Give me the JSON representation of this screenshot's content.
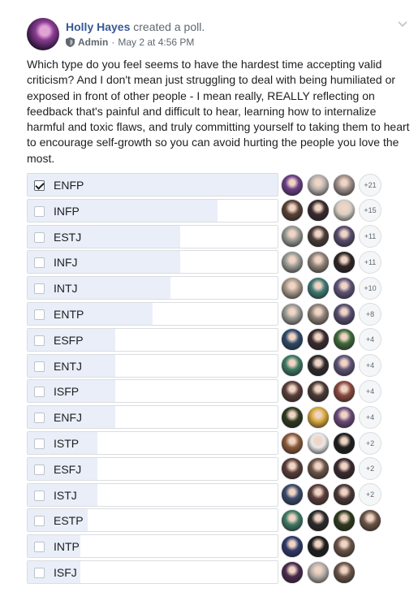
{
  "post": {
    "author": "Holly Hayes",
    "action": "created a poll.",
    "role": "Admin",
    "separator": "·",
    "timestamp": "May 2 at 4:56 PM",
    "text": "Which type do you feel seems to have the hardest time accepting valid criticism? And I don't mean just struggling to deal with being humiliated or exposed in front of other people - I mean really, REALLY reflecting on feedback that's painful and difficult to hear, learning how to internalize harmful and toxic flaws, and truly committing yourself to taking them to heart to encourage self-growth so you can avoid hurting the people you love the most."
  },
  "icons": {
    "menu": "chevron-down-icon",
    "role": "shield-icon",
    "check": "checkmark-icon"
  },
  "colors": {
    "author": "#385898",
    "bar_fill": "#e9eef8",
    "border": "#dadde1",
    "muted": "#606770"
  },
  "poll": {
    "options": [
      {
        "label": "ENFP",
        "checked": true,
        "fill_fraction": 1.0,
        "more": "+21",
        "voters": [
          "#6a3f86",
          "#b9b2ad",
          "#9c8f8a"
        ]
      },
      {
        "label": "INFP",
        "checked": false,
        "fill_fraction": 0.76,
        "more": "+15",
        "voters": [
          "#5a4236",
          "#3a2a2e",
          "#d8d0c6"
        ]
      },
      {
        "label": "ESTJ",
        "checked": false,
        "fill_fraction": 0.61,
        "more": "+11",
        "voters": [
          "#9a9a96",
          "#4a3c38",
          "#574d6e"
        ]
      },
      {
        "label": "INFJ",
        "checked": false,
        "fill_fraction": 0.61,
        "more": "+11",
        "voters": [
          "#9a9a96",
          "#8e8278",
          "#2e2624"
        ]
      },
      {
        "label": "INTJ",
        "checked": false,
        "fill_fraction": 0.57,
        "more": "+10",
        "voters": [
          "#a89888",
          "#3e7a74",
          "#5e5478"
        ]
      },
      {
        "label": "ENTP",
        "checked": false,
        "fill_fraction": 0.5,
        "more": "+8",
        "voters": [
          "#9a9a96",
          "#8e8278",
          "#574d6e"
        ]
      },
      {
        "label": "ESFP",
        "checked": false,
        "fill_fraction": 0.35,
        "more": "+4",
        "voters": [
          "#2f4a6a",
          "#3a2a2e",
          "#3e6a3a"
        ]
      },
      {
        "label": "ENTJ",
        "checked": false,
        "fill_fraction": 0.35,
        "more": "+4",
        "voters": [
          "#3e7a64",
          "#2e2a2c",
          "#5e5478"
        ]
      },
      {
        "label": "ISFP",
        "checked": false,
        "fill_fraction": 0.35,
        "more": "+4",
        "voters": [
          "#5a3e3a",
          "#4a3a36",
          "#8a4a3e"
        ]
      },
      {
        "label": "ENFJ",
        "checked": false,
        "fill_fraction": 0.35,
        "more": "+4",
        "voters": [
          "#2e3a1e",
          "#d8a83a",
          "#6a4a7a"
        ]
      },
      {
        "label": "ISTP",
        "checked": false,
        "fill_fraction": 0.28,
        "more": "+2",
        "voters": [
          "#8a5a3a",
          "#e8e8e8",
          "#1e1e1e"
        ]
      },
      {
        "label": "ESFJ",
        "checked": false,
        "fill_fraction": 0.28,
        "more": "+2",
        "voters": [
          "#5a3e3a",
          "#6a5448",
          "#3a2a2e"
        ]
      },
      {
        "label": "ISTJ",
        "checked": false,
        "fill_fraction": 0.28,
        "more": "+2",
        "voters": [
          "#3a4a6a",
          "#5a3e3a",
          "#4a3836"
        ]
      },
      {
        "label": "ESTP",
        "checked": false,
        "fill_fraction": 0.24,
        "more": "",
        "voters": [
          "#3e7a64",
          "#2a2a2a",
          "#2e3a1e",
          "#6a5448"
        ]
      },
      {
        "label": "INTP",
        "checked": false,
        "fill_fraction": 0.21,
        "more": "",
        "voters": [
          "#2f3a6a",
          "#1e1e1e",
          "#6a5448"
        ]
      },
      {
        "label": "ISFJ",
        "checked": false,
        "fill_fraction": 0.21,
        "more": "",
        "voters": [
          "#4a2a4e",
          "#b8b0aa",
          "#6a5448"
        ]
      }
    ]
  }
}
